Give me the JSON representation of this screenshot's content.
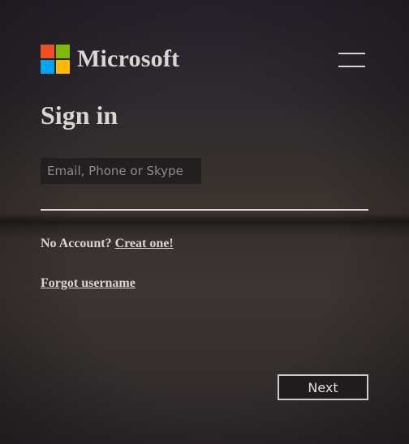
{
  "header": {
    "brand": "Microsoft",
    "logo_colors": [
      "#f25022",
      "#7fba00",
      "#00a4ef",
      "#ffb900"
    ]
  },
  "menu": {
    "icon": "hamburger-menu-icon"
  },
  "signin": {
    "title": "Sign in",
    "email_placeholder": "Email, Phone or Skype",
    "email_value": "",
    "no_account_text": "No Account?",
    "create_link": "Creat one!",
    "forgot_link": "Forgot username",
    "next_label": "Next"
  }
}
